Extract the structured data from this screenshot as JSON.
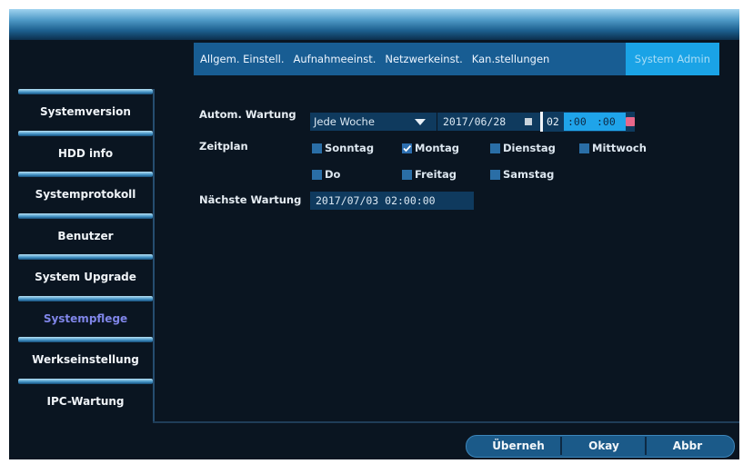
{
  "tabs": [
    {
      "label": "Allgem. Einstell."
    },
    {
      "label": "Aufnahmeeinst."
    },
    {
      "label": "Netzwerkeinst."
    },
    {
      "label": "Kan.stellungen"
    },
    {
      "label": "System Admin",
      "active": true
    }
  ],
  "sidebar": {
    "items": [
      {
        "label": "Systemversion"
      },
      {
        "label": "HDD info"
      },
      {
        "label": "Systemprotokoll"
      },
      {
        "label": "Benutzer"
      },
      {
        "label": "System Upgrade"
      },
      {
        "label": "Systempflege",
        "active": true
      },
      {
        "label": "Werkseinstellung"
      },
      {
        "label": "IPC-Wartung"
      }
    ]
  },
  "form": {
    "maintenance_label": "Autom. Wartung",
    "maintenance_value": "Jede Woche",
    "date_value": "2017/06/28",
    "time_hour": "02",
    "time_minute": ":00",
    "time_second": ":00",
    "schedule_label": "Zeitplan",
    "days": [
      {
        "label": "Sonntag",
        "checked": false
      },
      {
        "label": "Montag",
        "checked": true
      },
      {
        "label": "Dienstag",
        "checked": false
      },
      {
        "label": "Mittwoch",
        "checked": false
      },
      {
        "label": "Do",
        "checked": false
      },
      {
        "label": "Freitag",
        "checked": false
      },
      {
        "label": "Samstag",
        "checked": false
      }
    ],
    "next_label": "Nächste Wartung",
    "next_value": "2017/07/03  02:00:00"
  },
  "buttons": {
    "apply": "Überneh",
    "ok": "Okay",
    "cancel": "Abbr"
  },
  "colors": {
    "accent": "#1aa3e6",
    "active_sidebar_text": "#7f85e8",
    "background": "#0a1521"
  }
}
